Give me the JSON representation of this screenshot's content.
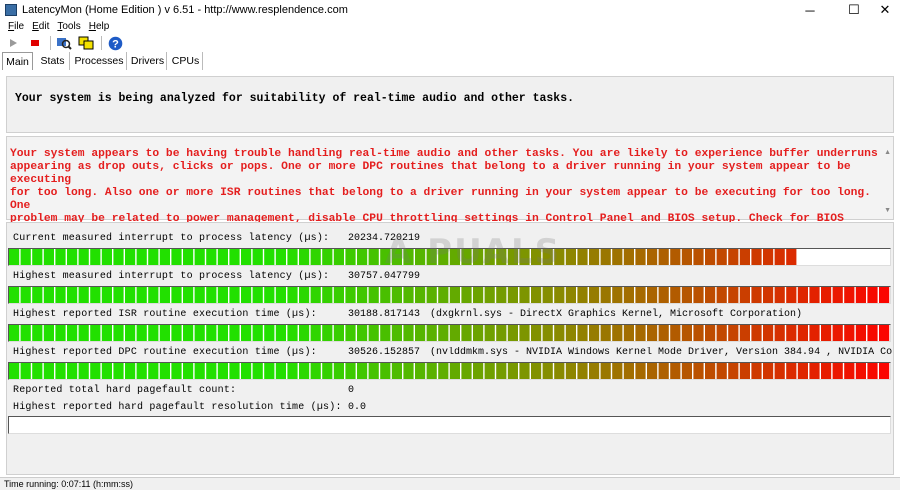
{
  "window": {
    "title": "LatencyMon  (Home Edition )  v 6.51 - http://www.resplendence.com",
    "minimize_glyph": "─",
    "maximize_glyph": "☐",
    "close_glyph": "✕"
  },
  "menu": [
    {
      "label": "File",
      "accel": "F",
      "rest": "ile"
    },
    {
      "label": "Edit",
      "accel": "E",
      "rest": "dit"
    },
    {
      "label": "Tools",
      "accel": "T",
      "rest": "ools"
    },
    {
      "label": "Help",
      "accel": "H",
      "rest": "elp"
    }
  ],
  "toolbar": {
    "icons": [
      "play-icon",
      "stop-icon",
      "search-icon",
      "windows-icon",
      "help-icon"
    ]
  },
  "tabs": [
    {
      "label": "Main",
      "active": true
    },
    {
      "label": "Stats",
      "active": false
    },
    {
      "label": "Processes",
      "active": false
    },
    {
      "label": "Drivers",
      "active": false
    },
    {
      "label": "CPUs",
      "active": false
    }
  ],
  "header": {
    "message": "Your system is being analyzed for suitability of real-time audio and other tasks."
  },
  "warning": {
    "color": "#e41e1e",
    "lines": [
      "Your system appears to be having trouble handling real-time audio and other tasks. You are likely to experience buffer underruns",
      "appearing as drop outs, clicks or pops. One or more DPC routines that belong to a driver running in your system appear to be executing",
      "for too long. Also one or more ISR routines that belong to a driver running in your system appear to be executing for too long. One",
      "problem may be related to power management, disable CPU throttling settings in Control Panel and BIOS setup. Check for BIOS updates."
    ]
  },
  "metrics": {
    "current": {
      "label": "Current measured interrupt to process latency (µs):",
      "value": "20234.720219",
      "fill_fraction": 0.89
    },
    "highest_latency": {
      "label": "Highest measured interrupt to process latency (µs):",
      "value": "30757.047799",
      "fill_fraction": 1.0
    },
    "isr": {
      "label": "Highest reported ISR routine execution time (µs):",
      "value": "30188.817143",
      "description": "(dxgkrnl.sys - DirectX Graphics Kernel, Microsoft Corporation)",
      "fill_fraction": 1.0
    },
    "dpc": {
      "label": "Highest reported DPC routine execution time (µs):",
      "value": "30526.152857",
      "description": "(nvlddmkm.sys - NVIDIA Windows Kernel Mode Driver, Version 384.94 , NVIDIA Corpor",
      "fill_fraction": 1.0
    },
    "pagefault_count": {
      "label": "Reported total hard pagefault count:",
      "value": "0"
    },
    "pagefault_time": {
      "label": "Highest reported hard pagefault resolution time (µs):",
      "value": "0.0",
      "fill_fraction": 0.0
    }
  },
  "colors": {
    "bar_green": "#22e000",
    "bar_olive": "#8a8a00",
    "bar_red": "#ff0000"
  },
  "status": {
    "text": "Time running: 0:07:11  (h:mm:ss)"
  }
}
